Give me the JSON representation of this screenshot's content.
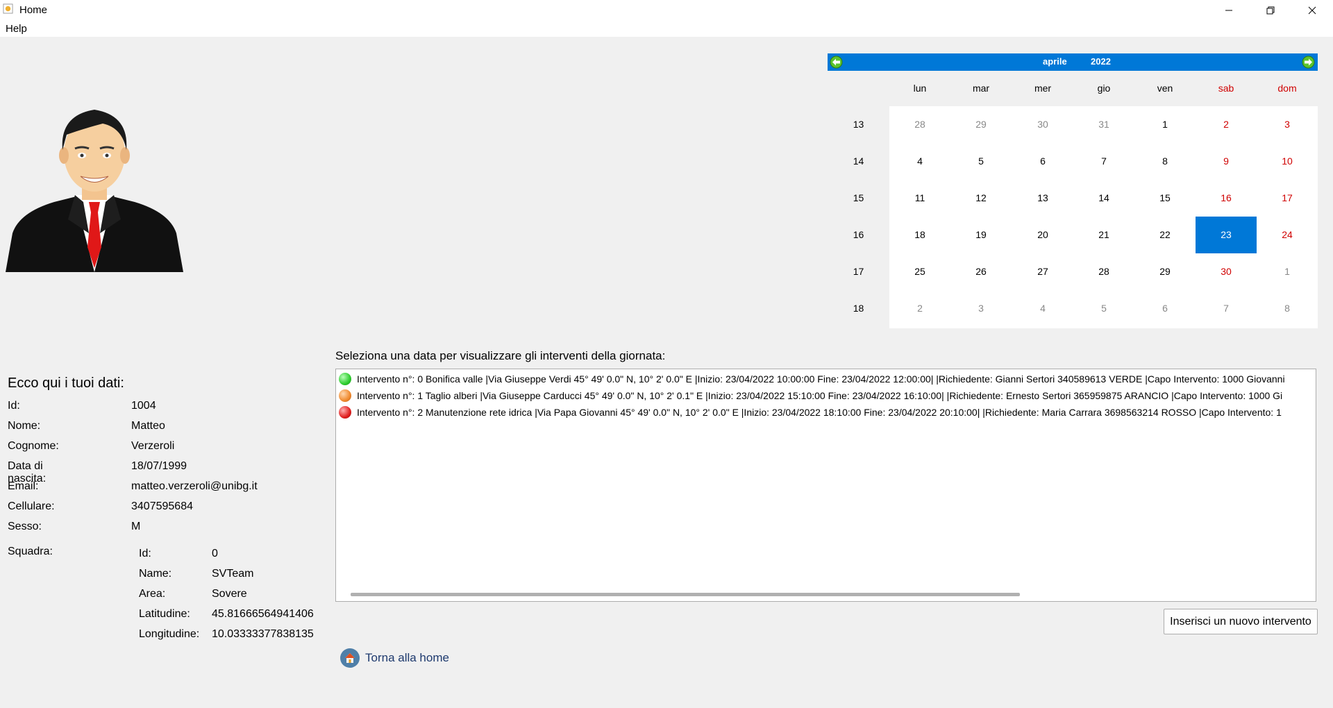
{
  "window": {
    "title": "Home"
  },
  "menu": {
    "items": [
      "Help"
    ]
  },
  "profile": {
    "section_title": "Ecco qui i tuoi dati:",
    "fields": [
      {
        "label": "Id:",
        "value": "1004"
      },
      {
        "label": "Nome:",
        "value": "Matteo"
      },
      {
        "label": "Cognome:",
        "value": "Verzeroli"
      },
      {
        "label": "Data di nascita:",
        "value": "18/07/1999"
      },
      {
        "label": "Email:",
        "value": "matteo.verzeroli@unibg.it"
      },
      {
        "label": "Cellulare:",
        "value": "3407595684"
      },
      {
        "label": "Sesso:",
        "value": "M"
      }
    ],
    "team_label": "Squadra:",
    "team_fields": [
      {
        "label": "Id:",
        "value": "0"
      },
      {
        "label": "Name:",
        "value": "SVTeam"
      },
      {
        "label": "Area:",
        "value": "Sovere"
      },
      {
        "label": "Latitudine:",
        "value": "45.81666564941406"
      },
      {
        "label": "Longitudine:",
        "value": "10.03333377838135"
      }
    ]
  },
  "calendar": {
    "month": "aprile",
    "year": "2022",
    "nav_color": "#0078d7",
    "weekday_headers": [
      "lun",
      "mar",
      "mer",
      "gio",
      "ven",
      "sab",
      "dom"
    ],
    "weeks": [
      {
        "number": "13",
        "days": [
          "28",
          "29",
          "30",
          "31",
          "1",
          "2",
          "3"
        ]
      },
      {
        "number": "14",
        "days": [
          "4",
          "5",
          "6",
          "7",
          "8",
          "9",
          "10"
        ]
      },
      {
        "number": "15",
        "days": [
          "11",
          "12",
          "13",
          "14",
          "15",
          "16",
          "17"
        ]
      },
      {
        "number": "16",
        "days": [
          "18",
          "19",
          "20",
          "21",
          "22",
          "23",
          "24"
        ]
      },
      {
        "number": "17",
        "days": [
          "25",
          "26",
          "27",
          "28",
          "29",
          "30",
          "1"
        ]
      },
      {
        "number": "18",
        "days": [
          "2",
          "3",
          "4",
          "5",
          "6",
          "7",
          "8"
        ]
      }
    ],
    "selected_day": "23"
  },
  "interventions": {
    "prompt": "Seleziona una data per visualizzare gli interventi della giornata:",
    "items": [
      {
        "status": "green",
        "color": "#2ecc2e",
        "text": "Intervento n°: 0 Bonifica valle |Via Giuseppe Verdi 45° 49' 0.0\" N, 10° 2' 0.0\" E |Inizio: 23/04/2022 10:00:00 Fine: 23/04/2022 12:00:00| |Richiedente:  Gianni Sertori 340589613 VERDE |Capo Intervento: 1000 Giovanni"
      },
      {
        "status": "orange",
        "color": "#f08a2e",
        "text": "Intervento n°: 1 Taglio alberi |Via Giuseppe Carducci 45° 49' 0.0\" N, 10° 2' 0.1\" E |Inizio: 23/04/2022 15:10:00 Fine: 23/04/2022 16:10:00| |Richiedente:  Ernesto Sertori 365959875 ARANCIO |Capo Intervento: 1000 Gi"
      },
      {
        "status": "red",
        "color": "#e02020",
        "text": "Intervento n°: 2 Manutenzione rete idrica |Via Papa Giovanni 45° 49' 0.0\" N, 10° 2' 0.0\" E |Inizio: 23/04/2022 18:10:00 Fine: 23/04/2022 20:10:00| |Richiedente:  Maria Carrara 3698563214 ROSSO |Capo Intervento: 1"
      }
    ],
    "new_button": "Inserisci un nuovo intervento"
  },
  "home_link": {
    "label": "Torna alla home",
    "icon": "home-icon"
  }
}
